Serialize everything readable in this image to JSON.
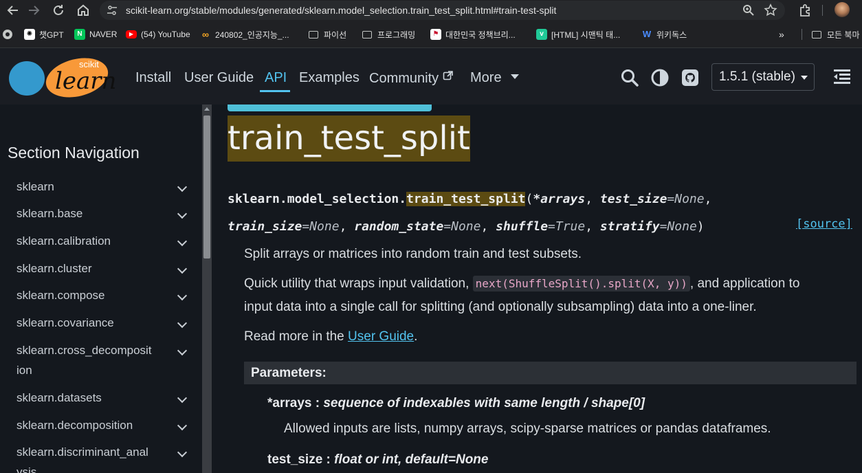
{
  "browser": {
    "url": "scikit-learn.org/stable/modules/generated/sklearn.model_selection.train_test_split.html#train-test-split",
    "bookmarks": [
      {
        "label": "챗GPT",
        "icon": "chatgpt-icon"
      },
      {
        "label": "NAVER",
        "icon": "naver-icon"
      },
      {
        "label": "(54) YouTube",
        "icon": "youtube-icon"
      },
      {
        "label": "240802_인공지능_...",
        "icon": "loop-icon"
      },
      {
        "label": "파이선",
        "icon": "folder-icon"
      },
      {
        "label": "프로그래밍",
        "icon": "folder-icon"
      },
      {
        "label": "대한민국 정책브리...",
        "icon": "gov-icon"
      },
      {
        "label": "[HTML] 시맨틱 태...",
        "icon": "v-icon"
      },
      {
        "label": "위키독스",
        "icon": "wikidocs-icon"
      },
      {
        "label": "모든 북마",
        "icon": "folder-icon"
      }
    ],
    "more_bookmarks": "»"
  },
  "header": {
    "logo_top": "scikit",
    "logo_bottom": "learn",
    "nav": [
      "Install",
      "User Guide",
      "API",
      "Examples",
      "Community",
      "More"
    ],
    "active_nav": "API",
    "version": "1.5.1 (stable)"
  },
  "sidebar": {
    "title": "Section Navigation",
    "items": [
      {
        "line1": "sklearn",
        "line2": ""
      },
      {
        "line1": "sklearn.base",
        "line2": ""
      },
      {
        "line1": "sklearn.calibration",
        "line2": ""
      },
      {
        "line1": "sklearn.cluster",
        "line2": ""
      },
      {
        "line1": "sklearn.compose",
        "line2": ""
      },
      {
        "line1": "sklearn.covariance",
        "line2": ""
      },
      {
        "line1": "sklearn.cross_decomposit",
        "line2": "ion"
      },
      {
        "line1": "sklearn.datasets",
        "line2": ""
      },
      {
        "line1": "sklearn.decomposition",
        "line2": ""
      },
      {
        "line1": "sklearn.discriminant_anal",
        "line2": "ysis"
      }
    ]
  },
  "main": {
    "title": "train_test_split",
    "signature": {
      "module": "sklearn.model_selection.",
      "func": "train_test_split",
      "open": "(",
      "p1": "*arrays",
      "sep": ", ",
      "p2": "test_size",
      "p2_default": "=None",
      "p3": "train_size",
      "p3_default": "=None",
      "p4": "random_state",
      "p4_default": "=None",
      "p5": "shuffle",
      "p5_default": "=True",
      "p6": "stratify",
      "p6_default": "=None",
      "close": ")",
      "line1_tail": ",",
      "source": "[source]"
    },
    "summary": "Split arrays or matrices into random train and test subsets.",
    "desc_pre": "Quick utility that wraps input validation,",
    "desc_code": "next(ShuffleSplit().split(X, y))",
    "desc_post": ", and application to",
    "desc_line2": "input data into a single call for splitting (and optionally subsampling) data into a one-liner.",
    "read_more_pre": "Read more in the",
    "read_more_link": "User Guide",
    "read_more_post": ".",
    "params_header": "Parameters:",
    "params": [
      {
        "name": "*arrays",
        "colon": " : ",
        "type": "sequence of indexables with same length / shape[0]",
        "desc": "Allowed inputs are lists, numpy arrays, scipy-sparse matrices or pandas dataframes."
      },
      {
        "name": "test_size",
        "colon": " : ",
        "type": "float or int, default=None",
        "desc": ""
      }
    ]
  }
}
